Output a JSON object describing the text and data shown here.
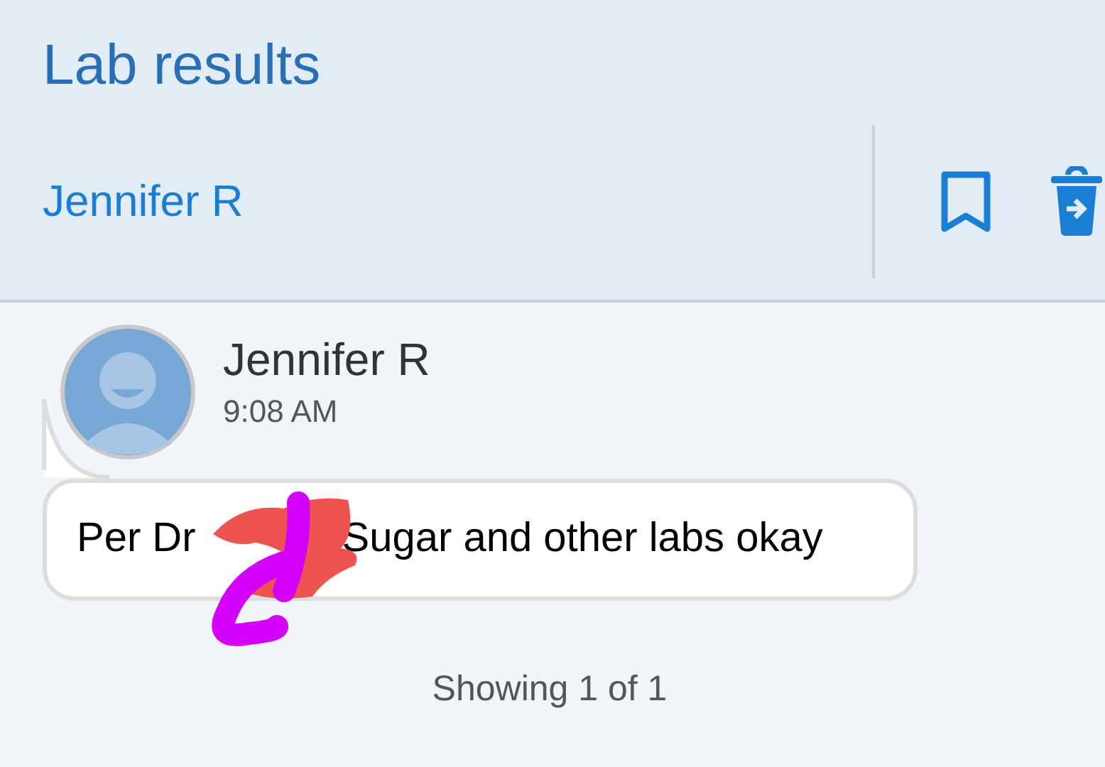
{
  "header": {
    "title": "Lab results",
    "sender": "Jennifer R"
  },
  "message": {
    "author": "Jennifer R",
    "time": "9:08 AM",
    "text_before": "Per Dr",
    "redacted": true,
    "text_after": "Sugar and other labs okay"
  },
  "footer": {
    "count": "Showing 1 of 1"
  }
}
